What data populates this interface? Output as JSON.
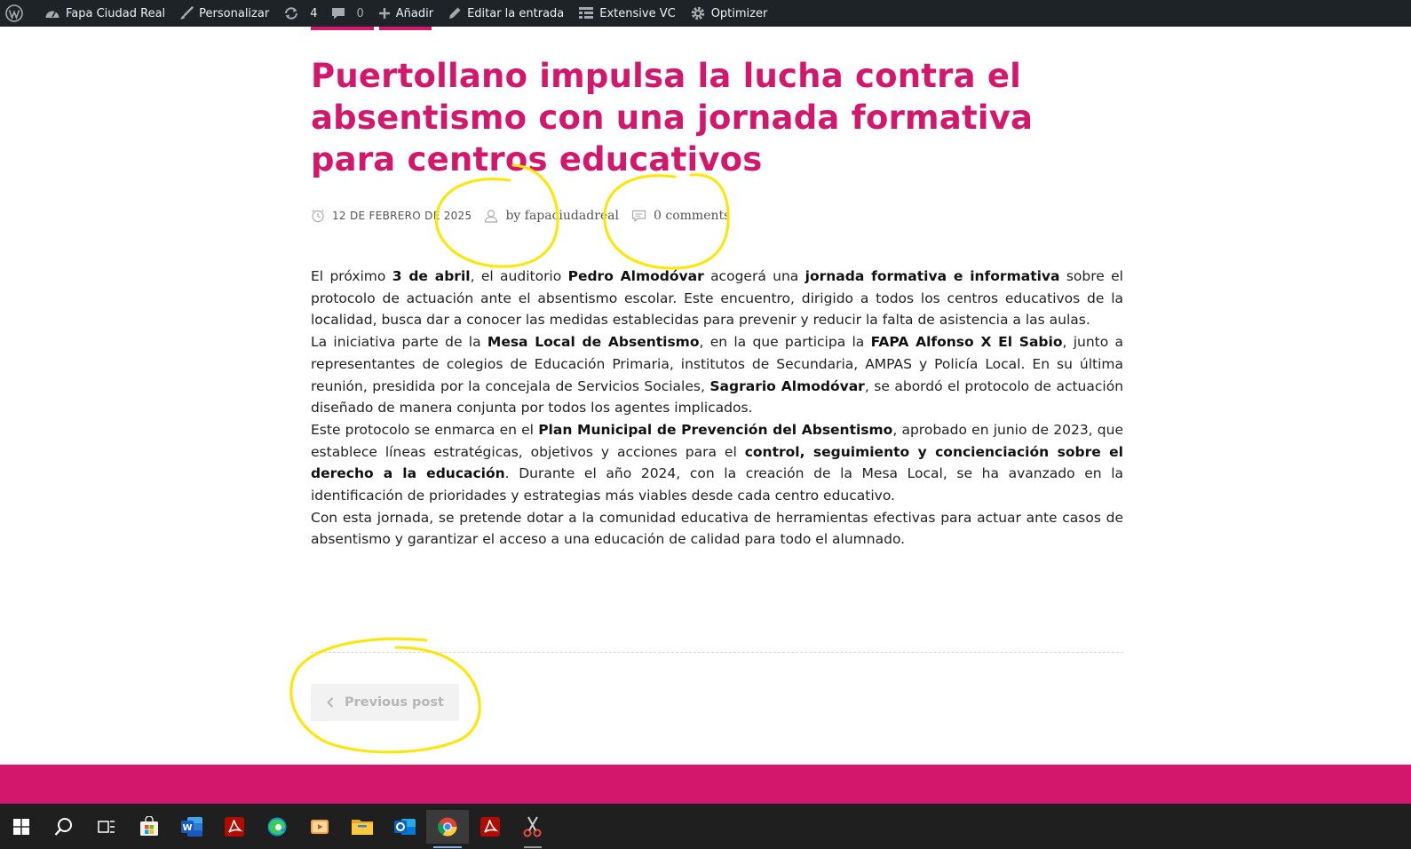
{
  "adminbar": {
    "site_name": "Fapa Ciudad Real",
    "customize": "Personalizar",
    "updates_count": "4",
    "comments_count": "0",
    "add_new": "Añadir",
    "edit_post": "Editar la entrada",
    "extensive_vc": "Extensive VC",
    "optimizer": "Optimizer"
  },
  "post": {
    "title": "Puertollano impulsa la lucha contra el absentismo con una jornada formativa para centros educativos",
    "date": "12 DE FEBRERO DE 2025",
    "author": "by fapaciudadreal",
    "comments": "0 comments",
    "p1": {
      "a": "El próximo ",
      "b1": "3 de abril",
      "c": ", el auditorio ",
      "b2": "Pedro Almodóvar",
      "d": " acogerá una ",
      "b3": "jornada formativa e informativa",
      "e": " sobre el protocolo de actuación ante el absentismo escolar. Este encuentro, dirigido a todos los centros educativos de la localidad, busca dar a conocer las medidas establecidas para prevenir y reducir la falta de asistencia a las aulas."
    },
    "p2": {
      "a": "La iniciativa parte de la ",
      "b1": "Mesa Local de Absentismo",
      "c": ", en la que participa la ",
      "b2": "FAPA Alfonso X El Sabio",
      "d": ", junto a representantes de colegios de Educación Primaria, institutos de Secundaria, AMPAS y Policía Local. En su última reunión, presidida por la concejala de Servicios Sociales, ",
      "b3": "Sagrario Almodóvar",
      "e": ", se abordó el protocolo de actuación diseñado de manera conjunta por todos los agentes implicados."
    },
    "p3": {
      "a": "Este protocolo se enmarca en el ",
      "b1": "Plan Municipal de Prevención del Absentismo",
      "c": ", aprobado en junio de 2023, que establece líneas estratégicas, objetivos y acciones para el ",
      "b2": "control, seguimiento y concienciación sobre el derecho a la educación",
      "d": ". Durante el año 2024, con la creación de la Mesa Local, se ha avanzado en la identificación de prioridades y estrategias más viables desde cada centro educativo."
    },
    "p4": "Con esta jornada, se pretende dotar a la comunidad educativa de herramientas efectivas para actuar ante casos de absentismo y garantizar el acceso a una educación de calidad para todo el alumnado.",
    "prev_post": "Previous post"
  },
  "colors": {
    "brand": "#d2176c",
    "adminbar": "#1d2327",
    "taskbar": "#1f1f1f",
    "annotation": "#ffe600"
  },
  "taskbar": {
    "icons": [
      "windows-start-icon",
      "search-icon",
      "task-view-icon",
      "store-icon",
      "word-icon",
      "acrobat-icon",
      "edge-icon",
      "media-player-icon",
      "file-explorer-icon",
      "outlook-icon",
      "chrome-icon",
      "acrobat-icon-2",
      "snipping-tool-icon"
    ]
  }
}
